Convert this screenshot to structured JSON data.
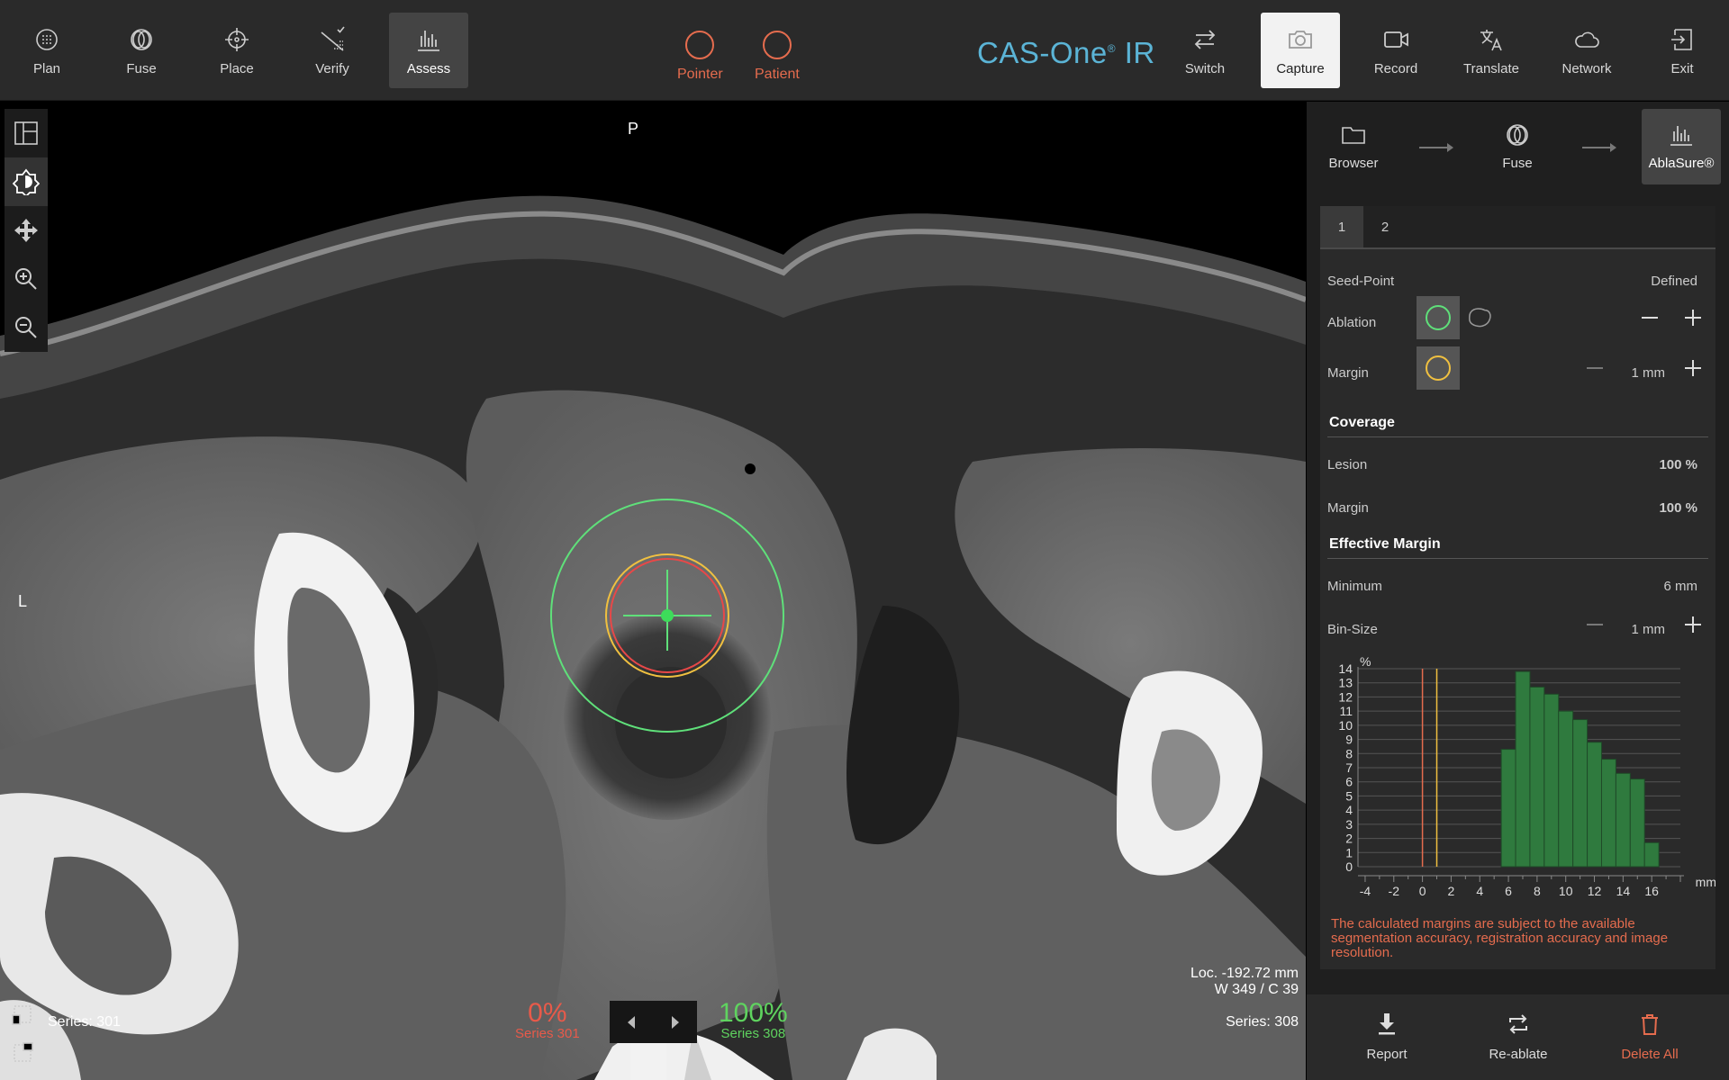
{
  "toolbar": {
    "left": [
      {
        "label": "Plan",
        "icon": "plan-icon"
      },
      {
        "label": "Fuse",
        "icon": "fuse-icon"
      },
      {
        "label": "Place",
        "icon": "crosshair-icon"
      },
      {
        "label": "Verify",
        "icon": "verify-icon"
      },
      {
        "label": "Assess",
        "icon": "assess-chart-icon",
        "active": true
      }
    ],
    "status": [
      {
        "label": "Pointer",
        "color": "#e56c4e"
      },
      {
        "label": "Patient",
        "color": "#e56c4e"
      }
    ],
    "brand": "CAS-One",
    "brand_mark": "®",
    "brand_suffix": " IR",
    "right": [
      {
        "label": "Switch",
        "icon": "switch-icon"
      },
      {
        "label": "Capture",
        "icon": "camera-icon",
        "highlighted": true
      },
      {
        "label": "Record",
        "icon": "video-camera-icon"
      },
      {
        "label": "Translate",
        "icon": "translate-icon"
      },
      {
        "label": "Network",
        "icon": "cloud-icon"
      },
      {
        "label": "Exit",
        "icon": "exit-icon"
      }
    ]
  },
  "viewer": {
    "orientation_top": "P",
    "orientation_left": "L",
    "series_left": "Series: 301",
    "series_right": "Series: 308",
    "location": "Loc. -192.72 mm",
    "window": "W 349 / C 39",
    "left_percent": "0%",
    "left_percent_series": "Series 301",
    "right_percent": "100%",
    "right_percent_series": "Series 308",
    "colors": {
      "left_percent": "#e85a4a",
      "right_percent": "#5fd35f",
      "ablation": "#5fe07a",
      "margin": "#f0c040",
      "lesion": "#e84848"
    }
  },
  "workflow": {
    "steps": [
      {
        "label": "Browser",
        "icon": "folder-icon"
      },
      {
        "label": "Fuse",
        "icon": "fuse-icon"
      },
      {
        "label": "AblaSure®",
        "icon": "assess-chart-icon",
        "active": true
      }
    ]
  },
  "panel": {
    "tabs": [
      "1",
      "2"
    ],
    "seed_point": {
      "label": "Seed-Point",
      "value": "Defined"
    },
    "ablation": {
      "label": "Ablation"
    },
    "margin": {
      "label": "Margin",
      "value": "1 mm"
    },
    "coverage": {
      "title": "Coverage",
      "lesion_label": "Lesion",
      "lesion_value": "100 %",
      "margin_label": "Margin",
      "margin_value": "100 %"
    },
    "effective_margin": {
      "title": "Effective Margin",
      "minimum_label": "Minimum",
      "minimum_value": "6 mm",
      "binsize_label": "Bin-Size",
      "binsize_value": "1 mm"
    },
    "warning": "The calculated margins are subject to the available segmentation accuracy, registration accuracy and image resolution."
  },
  "chart_data": {
    "type": "bar",
    "ylabel": "%",
    "xlabel": "mm",
    "xlim": [
      -4.5,
      18
    ],
    "ylim": [
      0,
      14
    ],
    "xticks": [
      -4,
      -2,
      0,
      2,
      4,
      6,
      8,
      10,
      12,
      14,
      16
    ],
    "yticks": [
      0,
      1,
      2,
      3,
      4,
      5,
      6,
      7,
      8,
      9,
      10,
      11,
      12,
      13,
      14
    ],
    "bin_size": 1,
    "bins": [
      5.5,
      6.5,
      7.5,
      8.5,
      9.5,
      10.5,
      11.5,
      12.5,
      13.5,
      14.5,
      15.5,
      16.5
    ],
    "values": [
      8.3,
      13.8,
      12.7,
      12.2,
      11.0,
      10.4,
      8.8,
      7.6,
      6.6,
      6.2,
      1.7
    ],
    "reference_lines": [
      {
        "x": 0,
        "color": "#e56c4e"
      },
      {
        "x": 1,
        "color": "#f0c040"
      }
    ],
    "bar_color": "#2f7a3e"
  },
  "bottom": [
    {
      "label": "Report",
      "icon": "download-icon"
    },
    {
      "label": "Re-ablate",
      "icon": "repeat-icon"
    },
    {
      "label": "Delete All",
      "icon": "trash-icon",
      "danger": true
    }
  ]
}
